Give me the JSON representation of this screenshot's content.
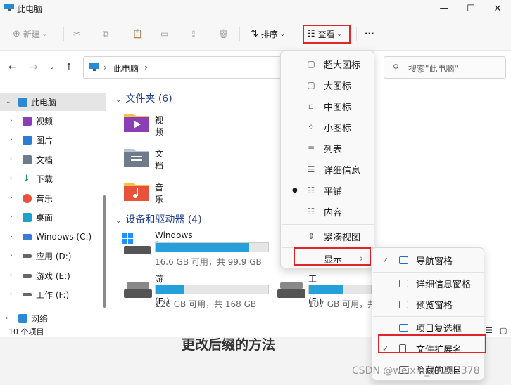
{
  "window": {
    "title": "此电脑"
  },
  "toolbar": {
    "new_label": "新建",
    "sort_label": "排序",
    "view_label": "查看",
    "more_label": "···"
  },
  "address": {
    "path": "此电脑",
    "search_placeholder": "搜索\"此电脑\""
  },
  "sidebar": {
    "items": [
      {
        "label": "此电脑",
        "color": "#2a8ad4"
      },
      {
        "label": "视频",
        "color": "#8b3fb5"
      },
      {
        "label": "图片",
        "color": "#2b7dd3"
      },
      {
        "label": "文档",
        "color": "#6e7b8b"
      },
      {
        "label": "下载",
        "color": "#1e9b56"
      },
      {
        "label": "音乐",
        "color": "#e8513a"
      },
      {
        "label": "桌面",
        "color": "#1fa0c8"
      },
      {
        "label": "Windows (C:)",
        "color": "#3a7bd5"
      },
      {
        "label": "应用 (D:)",
        "color": "#666666"
      },
      {
        "label": "游戏 (E:)",
        "color": "#666666"
      },
      {
        "label": "工作 (F:)",
        "color": "#666666"
      },
      {
        "label": "网络",
        "color": "#2a8ad4"
      }
    ]
  },
  "main": {
    "folders_header": "文件夹 (6)",
    "folders": [
      {
        "name": "视频",
        "color": "#8b3fb5"
      },
      {
        "name": "文档",
        "color": "#6e7b8b"
      },
      {
        "name": "音乐",
        "color": "#e8513a"
      }
    ],
    "drives_header": "设备和驱动器 (4)",
    "drives": [
      {
        "name": "Windows (C:)",
        "sub": "16.6 GB 可用，共 99.9 GB",
        "used": 0.834
      },
      {
        "name": "游戏 (E:)",
        "sub": "126 GB 可用，共 168 GB",
        "used": 0.25
      },
      {
        "name": "工作 (F:)",
        "sub": "107 GB 可用，共",
        "used": 0.55
      }
    ]
  },
  "status": {
    "count": "10 个项目"
  },
  "view_menu": {
    "items": [
      "超大图标",
      "大图标",
      "中图标",
      "小图标",
      "列表",
      "详细信息",
      "平铺",
      "内容",
      "紧凑视图",
      "显示"
    ]
  },
  "show_submenu": {
    "items": [
      "导航窗格",
      "详细信息窗格",
      "预览窗格",
      "项目复选框",
      "文件扩展名",
      "隐藏的项目"
    ]
  },
  "background_text": "更改后缀的方法",
  "watermark": "CSDN @weixin_57242378",
  "colors": {
    "accent": "#26a0da",
    "highlight": "#e0242a"
  }
}
